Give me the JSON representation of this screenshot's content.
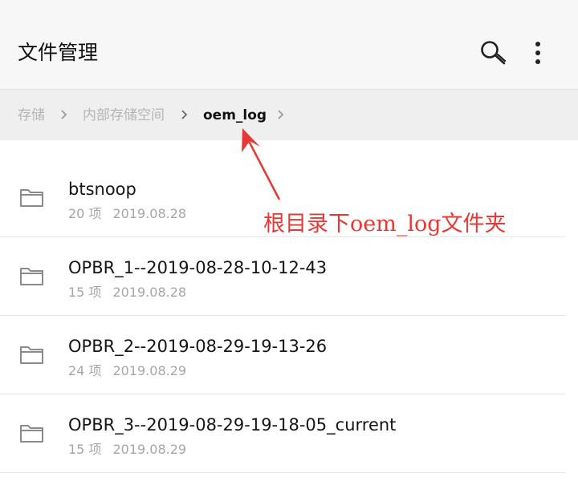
{
  "app": {
    "title": "文件管理"
  },
  "header": {
    "search_icon": "search-icon",
    "more_icon": "more-vertical-icon"
  },
  "breadcrumb": {
    "items": [
      "存储",
      "内部存储空间",
      "oem_log"
    ]
  },
  "files": [
    {
      "name": "btsnoop",
      "count": "20 项",
      "date": "2019.08.28"
    },
    {
      "name": "OPBR_1--2019-08-28-10-12-43",
      "count": "15 项",
      "date": "2019.08.28"
    },
    {
      "name": "OPBR_2--2019-08-29-19-13-26",
      "count": "24 项",
      "date": "2019.08.29"
    },
    {
      "name": "OPBR_3--2019-08-29-19-18-05_current",
      "count": "15 项",
      "date": "2019.08.29"
    }
  ],
  "annotation": {
    "text": "根目录下oem_log文件夹",
    "color": "#e53935"
  }
}
